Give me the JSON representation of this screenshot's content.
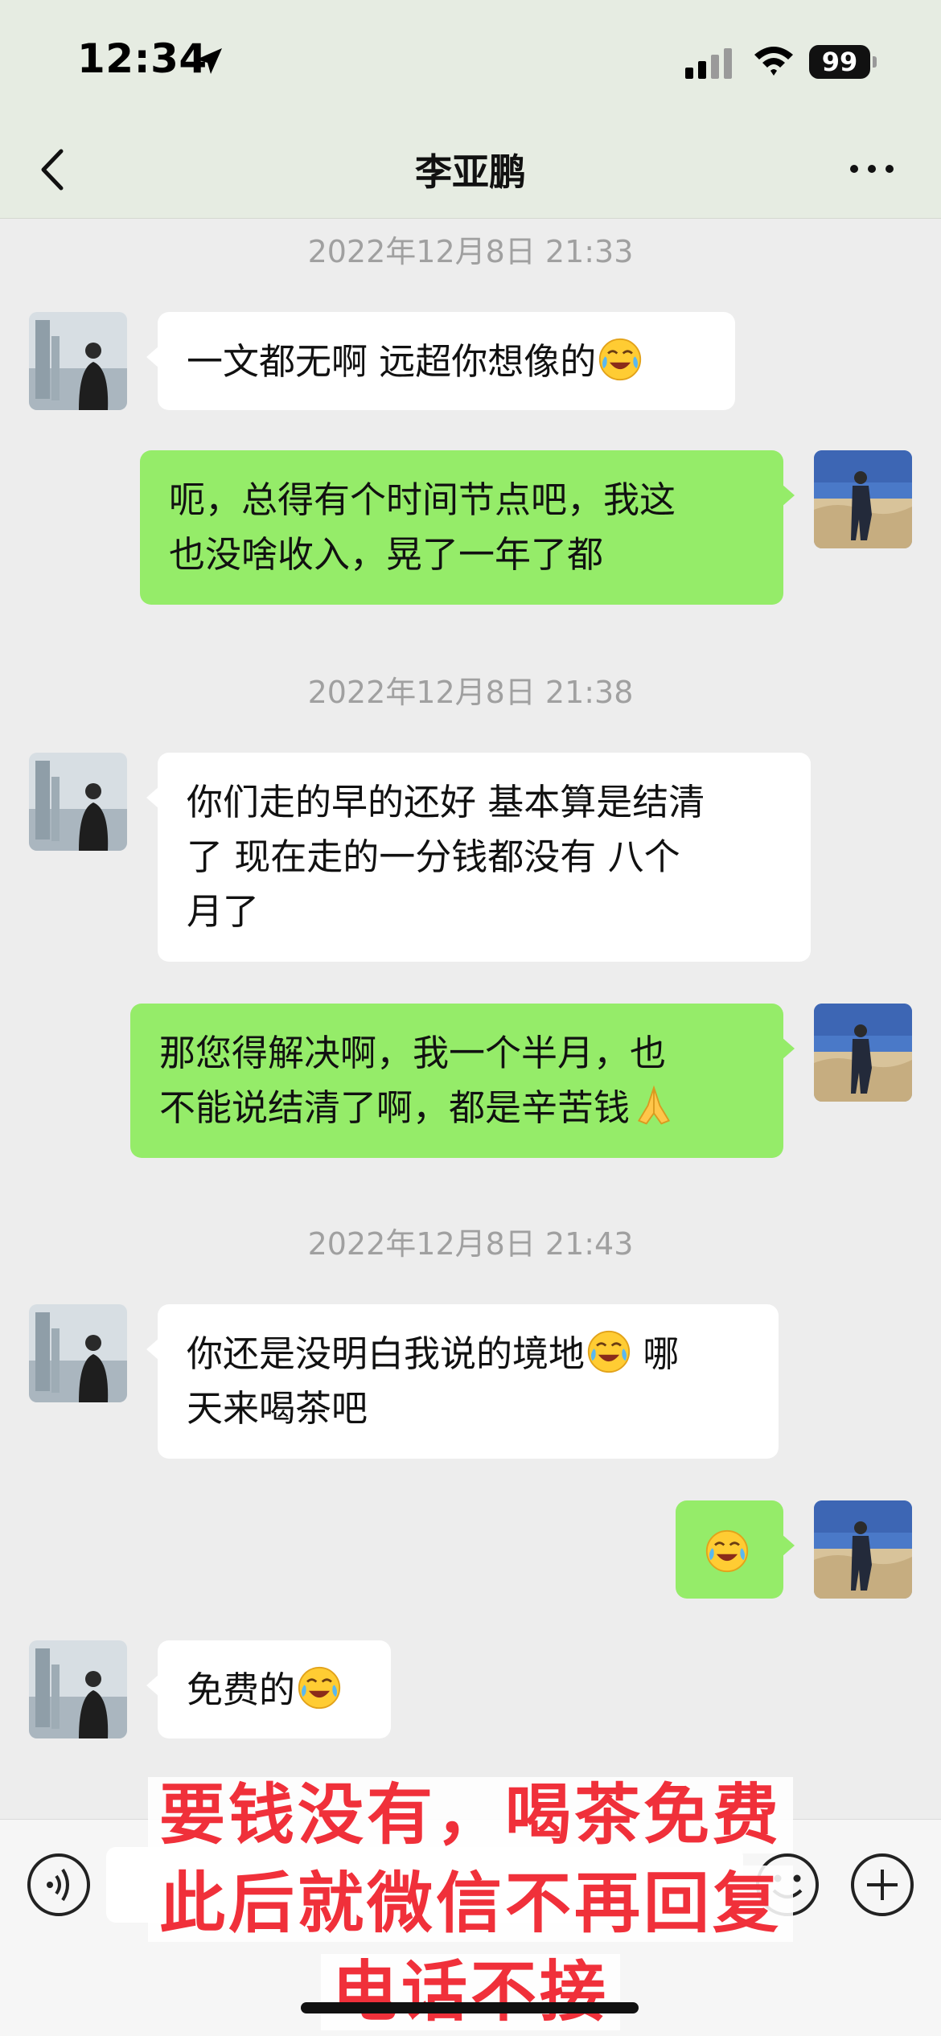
{
  "status_bar": {
    "time": "12:34",
    "battery": "99"
  },
  "header": {
    "title": "李亚鹏"
  },
  "messages": {
    "ts1": "2022年12月8日 21:33",
    "m1": "一文都无啊 远超你想像的",
    "m2_line1": "呃，总得有个时间节点吧，我这",
    "m2_line2": "也没啥收入，晃了一年了都",
    "ts2": "2022年12月8日 21:38",
    "m3_line1": "你们走的早的还好 基本算是结清",
    "m3_line2": "了 现在走的一分钱都没有 八个",
    "m3_line3": "月了",
    "m4_line1": "那您得解决啊，我一个半月，也",
    "m4_line2": "不能说结清了啊，都是辛苦钱",
    "ts3": "2022年12月8日 21:43",
    "m5_line1": "你还是没明白我说的境地",
    "m5_line1b": "哪",
    "m5_line2": "天来喝茶吧",
    "m7": "免费的"
  },
  "overlay_caption": {
    "line1": "要钱没有，喝茶免费",
    "line2": "此后就微信不再回复",
    "line3": "电话不接"
  },
  "icons": {
    "back": "chevron-left-icon",
    "more": "more-dots-icon",
    "voice": "voice-icon",
    "emoji": "smile-icon",
    "plus": "plus-icon",
    "tears": "tears-of-joy-emoji",
    "pray": "praying-hands-emoji"
  },
  "colors": {
    "outgoing_bubble": "#95ec69",
    "incoming_bubble": "#ffffff",
    "caption": "#f0303a",
    "background": "#ededed"
  }
}
